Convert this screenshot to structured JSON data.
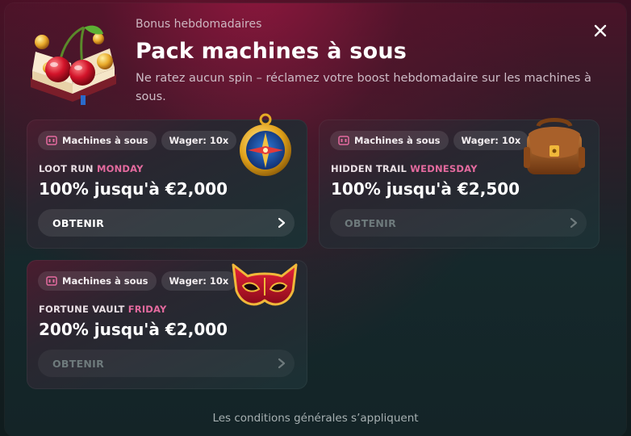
{
  "header": {
    "subtitle": "Bonus hebdomadaires",
    "title": "Pack machines à sous",
    "description": "Ne ratez aucun spin – réclamez votre boost hebdomadaire sur les machines à sous.",
    "close_icon": "close-icon",
    "hero_icon": "cherry-book-icon"
  },
  "offers": [
    {
      "tag_category": "Machines à sous",
      "tag_wager": "Wager: 10x",
      "name_prefix": "LOOT RUN ",
      "name_day": "MONDAY",
      "amount": "100% jusqu'à €2,000",
      "button_label": "OBTENIR",
      "button_enabled": true,
      "icon": "compass-icon"
    },
    {
      "tag_category": "Machines à sous",
      "tag_wager": "Wager: 10x",
      "name_prefix": "HIDDEN TRAIL ",
      "name_day": "WEDNESDAY",
      "amount": "100% jusqu'à €2,500",
      "button_label": "OBTENIR",
      "button_enabled": false,
      "icon": "satchel-icon"
    },
    {
      "tag_category": "Machines à sous",
      "tag_wager": "Wager: 10x",
      "name_prefix": "FORTUNE VAULT ",
      "name_day": "FRIDAY",
      "amount": "200% jusqu'à €2,000",
      "button_label": "OBTENIR",
      "button_enabled": false,
      "icon": "mask-icon"
    }
  ],
  "footer": {
    "terms": "Les conditions générales s’appliquent"
  },
  "colors": {
    "accent_day": "#e36a9e",
    "modal_top": "#4a1328",
    "modal_bottom": "#142427"
  }
}
